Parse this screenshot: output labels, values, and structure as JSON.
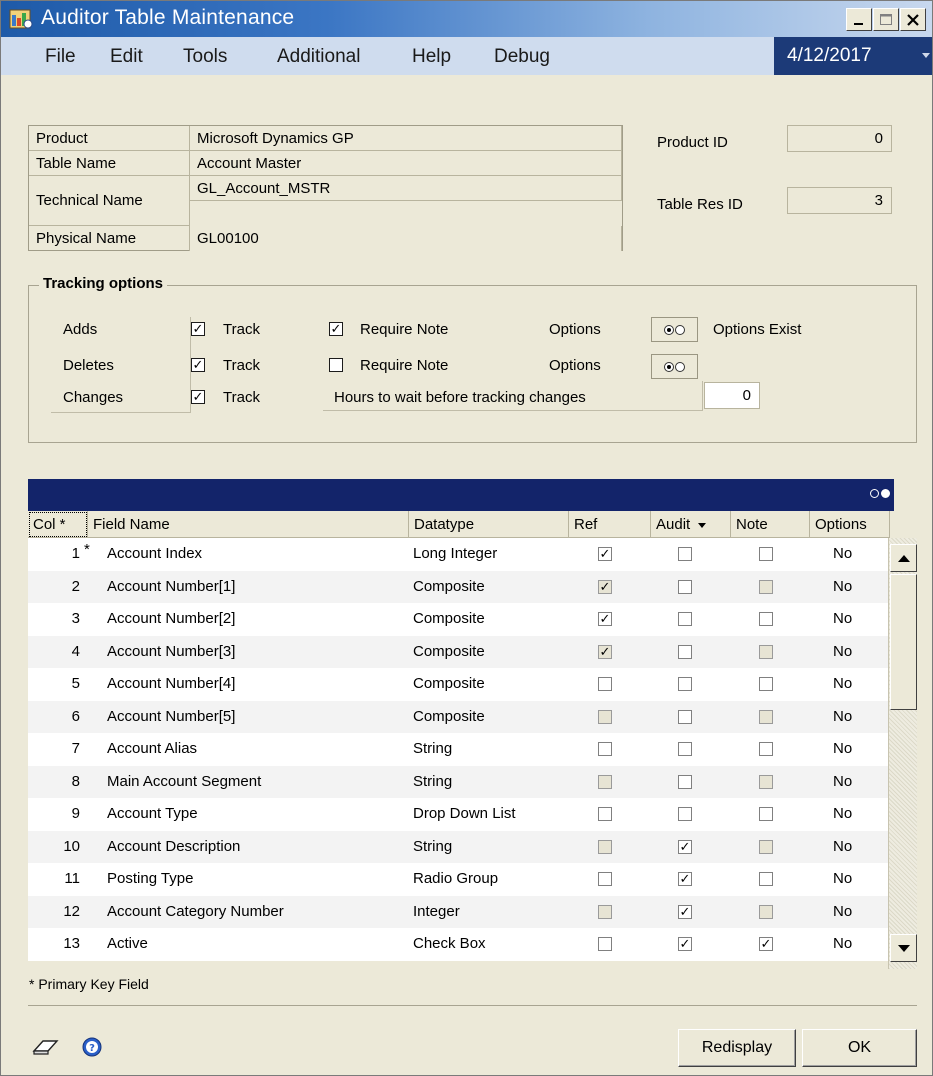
{
  "window": {
    "title": "Auditor Table Maintenance"
  },
  "menu": {
    "items": [
      "File",
      "Edit",
      "Tools",
      "Additional",
      "Help",
      "Debug"
    ],
    "date": "4/12/2017"
  },
  "info": {
    "product_label": "Product",
    "product_value": "Microsoft Dynamics GP",
    "table_name_label": "Table Name",
    "table_name_value": "Account Master",
    "technical_name_label": "Technical Name",
    "technical_name_value": "GL_Account_MSTR",
    "physical_name_label": "Physical Name",
    "physical_name_value": "GL00100",
    "product_id_label": "Product ID",
    "product_id_value": "0",
    "table_res_id_label": "Table Res ID",
    "table_res_id_value": "3"
  },
  "tracking": {
    "title": "Tracking options",
    "adds": {
      "label": "Adds",
      "track": "Track",
      "require_note": "Require Note",
      "options": "Options",
      "track_checked": true,
      "note_checked": true,
      "status": "Options Exist"
    },
    "deletes": {
      "label": "Deletes",
      "track": "Track",
      "require_note": "Require Note",
      "options": "Options",
      "track_checked": true,
      "note_checked": false
    },
    "changes": {
      "label": "Changes",
      "track": "Track",
      "track_checked": true,
      "hours_label": "Hours to wait before tracking changes",
      "hours_value": "0"
    }
  },
  "table": {
    "headers": {
      "col": "Col *",
      "field": "Field Name",
      "datatype": "Datatype",
      "ref": "Ref",
      "audit": "Audit",
      "note": "Note",
      "options": "Options"
    },
    "rows": [
      {
        "col": "1",
        "pk": "*",
        "field": "Account Index",
        "datatype": "Long Integer",
        "ref": true,
        "audit": false,
        "note": false,
        "options": "No"
      },
      {
        "col": "2",
        "pk": "",
        "field": "Account Number[1]",
        "datatype": "Composite",
        "ref": true,
        "audit": false,
        "note": false,
        "options": "No"
      },
      {
        "col": "3",
        "pk": "",
        "field": "Account Number[2]",
        "datatype": "Composite",
        "ref": true,
        "audit": false,
        "note": false,
        "options": "No"
      },
      {
        "col": "4",
        "pk": "",
        "field": "Account Number[3]",
        "datatype": "Composite",
        "ref": true,
        "audit": false,
        "note": false,
        "options": "No"
      },
      {
        "col": "5",
        "pk": "",
        "field": "Account Number[4]",
        "datatype": "Composite",
        "ref": false,
        "audit": false,
        "note": false,
        "options": "No"
      },
      {
        "col": "6",
        "pk": "",
        "field": "Account Number[5]",
        "datatype": "Composite",
        "ref": false,
        "audit": false,
        "note": false,
        "options": "No"
      },
      {
        "col": "7",
        "pk": "",
        "field": "Account Alias",
        "datatype": "String",
        "ref": false,
        "audit": false,
        "note": false,
        "options": "No"
      },
      {
        "col": "8",
        "pk": "",
        "field": "Main Account Segment",
        "datatype": "String",
        "ref": false,
        "audit": false,
        "note": false,
        "options": "No"
      },
      {
        "col": "9",
        "pk": "",
        "field": "Account Type",
        "datatype": "Drop Down List",
        "ref": false,
        "audit": false,
        "note": false,
        "options": "No"
      },
      {
        "col": "10",
        "pk": "",
        "field": "Account Description",
        "datatype": "String",
        "ref": false,
        "audit": true,
        "note": false,
        "options": "No"
      },
      {
        "col": "11",
        "pk": "",
        "field": "Posting Type",
        "datatype": "Radio Group",
        "ref": false,
        "audit": true,
        "note": false,
        "options": "No"
      },
      {
        "col": "12",
        "pk": "",
        "field": "Account Category Number",
        "datatype": "Integer",
        "ref": false,
        "audit": true,
        "note": false,
        "options": "No"
      },
      {
        "col": "13",
        "pk": "",
        "field": "Active",
        "datatype": "Check Box",
        "ref": false,
        "audit": true,
        "note": true,
        "options": "No"
      }
    ]
  },
  "footnote": "* Primary Key Field",
  "buttons": {
    "redisplay": "Redisplay",
    "ok": "OK"
  }
}
